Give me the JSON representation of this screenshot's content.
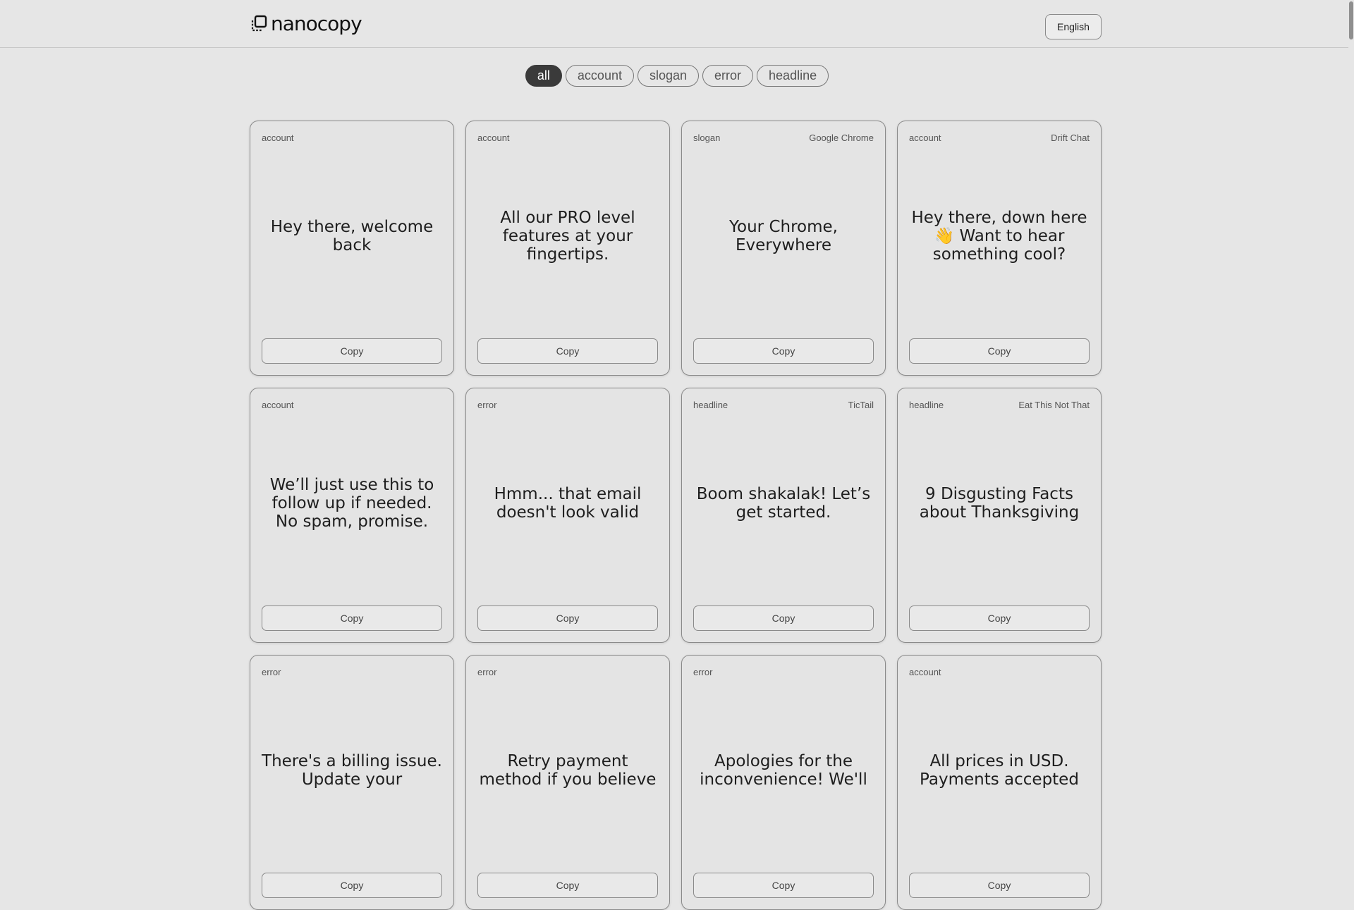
{
  "header": {
    "logo_text": "nanocopy",
    "language_label": "English"
  },
  "filters": [
    "all",
    "account",
    "slogan",
    "error",
    "headline"
  ],
  "active_filter": "all",
  "cards": [
    {
      "tag": "account",
      "source": "",
      "text": "Hey there, welcome back",
      "copy_label": "Copy"
    },
    {
      "tag": "account",
      "source": "",
      "text": "All our PRO level features at your fingertips.",
      "copy_label": "Copy"
    },
    {
      "tag": "slogan",
      "source": "Google Chrome",
      "text": "Your Chrome, Everywhere",
      "copy_label": "Copy"
    },
    {
      "tag": "account",
      "source": "Drift Chat",
      "text": "Hey there, down here 👋 Want to hear something cool?",
      "copy_label": "Copy"
    },
    {
      "tag": "account",
      "source": "",
      "text": "We’ll just use this to follow up if needed. No spam, promise.",
      "copy_label": "Copy"
    },
    {
      "tag": "error",
      "source": "",
      "text": "Hmm... that email doesn't look valid",
      "copy_label": "Copy"
    },
    {
      "tag": "headline",
      "source": "TicTail",
      "text": "Boom shakalak! Let’s get started.",
      "copy_label": "Copy"
    },
    {
      "tag": "headline",
      "source": "Eat This Not That",
      "text": "9 Disgusting Facts about Thanksgiving",
      "copy_label": "Copy"
    },
    {
      "tag": "error",
      "source": "",
      "text": "There's a billing issue. Update your",
      "copy_label": "Copy"
    },
    {
      "tag": "error",
      "source": "",
      "text": "Retry payment method if you believe",
      "copy_label": "Copy"
    },
    {
      "tag": "error",
      "source": "",
      "text": "Apologies for the inconvenience! We'll",
      "copy_label": "Copy"
    },
    {
      "tag": "account",
      "source": "",
      "text": "All prices in USD. Payments accepted",
      "copy_label": "Copy"
    }
  ]
}
